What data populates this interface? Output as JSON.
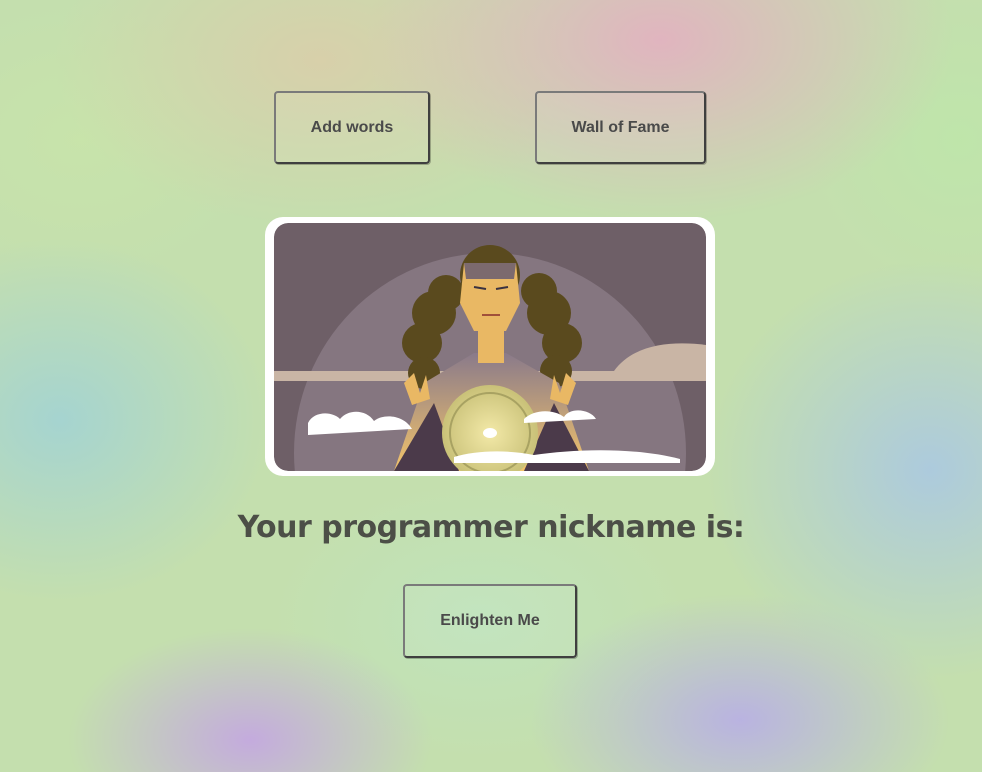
{
  "nav": {
    "add_words_label": "Add words",
    "wall_of_fame_label": "Wall of Fame"
  },
  "hero": {
    "illustration": "woman-holding-glowing-lemon-illustration"
  },
  "main": {
    "heading": "Your programmer nickname is:",
    "enlighten_label": "Enlighten Me"
  },
  "colors": {
    "text": "#4c4f47",
    "button_border": "#3f3f3f",
    "illustration_bg": "#6e5f67"
  }
}
